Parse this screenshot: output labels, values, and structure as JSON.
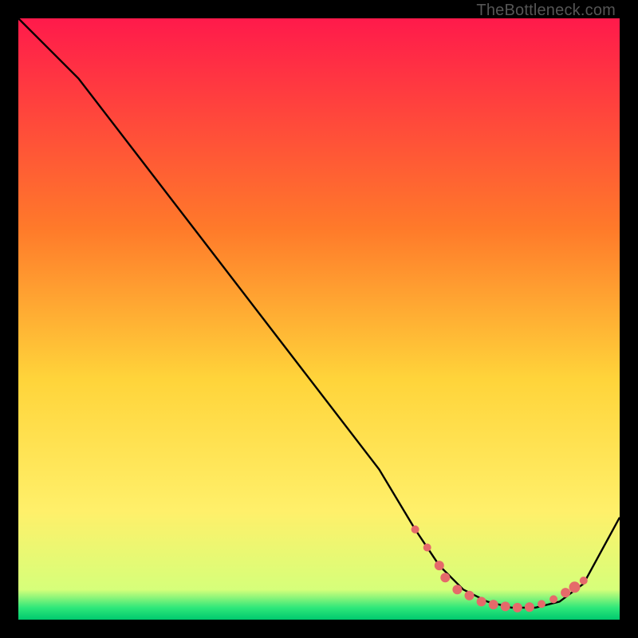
{
  "watermark": "TheBottleneck.com",
  "colors": {
    "gradient_top": "#ff1a4b",
    "gradient_mid1": "#ff7a2a",
    "gradient_mid2": "#ffd43a",
    "gradient_mid3": "#fff06a",
    "gradient_bottom": "#2fe87a",
    "gradient_bottom2": "#00c96e",
    "curve": "#000000",
    "marker_fill": "#e56a6a",
    "marker_stroke": "#c94f4f",
    "background": "#000000"
  },
  "chart_data": {
    "type": "line",
    "title": "",
    "xlabel": "",
    "ylabel": "",
    "xlim": [
      0,
      100
    ],
    "ylim": [
      0,
      100
    ],
    "grid": false,
    "legend": false,
    "series": [
      {
        "name": "bottleneck-curve",
        "x": [
          0,
          4,
          10,
          20,
          30,
          40,
          50,
          60,
          66,
          70,
          74,
          78,
          82,
          86,
          90,
          94,
          100
        ],
        "y": [
          100,
          96,
          90,
          77,
          64,
          51,
          38,
          25,
          15,
          9,
          5,
          3,
          2,
          2,
          3,
          6,
          17
        ]
      }
    ],
    "markers": {
      "name": "dotted-valley",
      "points": [
        {
          "x": 66,
          "y": 15,
          "r": 5
        },
        {
          "x": 68,
          "y": 12,
          "r": 5
        },
        {
          "x": 70,
          "y": 9,
          "r": 6
        },
        {
          "x": 71,
          "y": 7,
          "r": 6
        },
        {
          "x": 73,
          "y": 5,
          "r": 6
        },
        {
          "x": 75,
          "y": 4,
          "r": 6
        },
        {
          "x": 77,
          "y": 3,
          "r": 6
        },
        {
          "x": 79,
          "y": 2.5,
          "r": 6
        },
        {
          "x": 81,
          "y": 2.2,
          "r": 6
        },
        {
          "x": 83,
          "y": 2.0,
          "r": 6
        },
        {
          "x": 85,
          "y": 2.1,
          "r": 6
        },
        {
          "x": 87,
          "y": 2.6,
          "r": 5
        },
        {
          "x": 89,
          "y": 3.4,
          "r": 5
        },
        {
          "x": 91,
          "y": 4.5,
          "r": 6
        },
        {
          "x": 92.5,
          "y": 5.4,
          "r": 7
        },
        {
          "x": 94,
          "y": 6.5,
          "r": 5
        }
      ]
    }
  }
}
